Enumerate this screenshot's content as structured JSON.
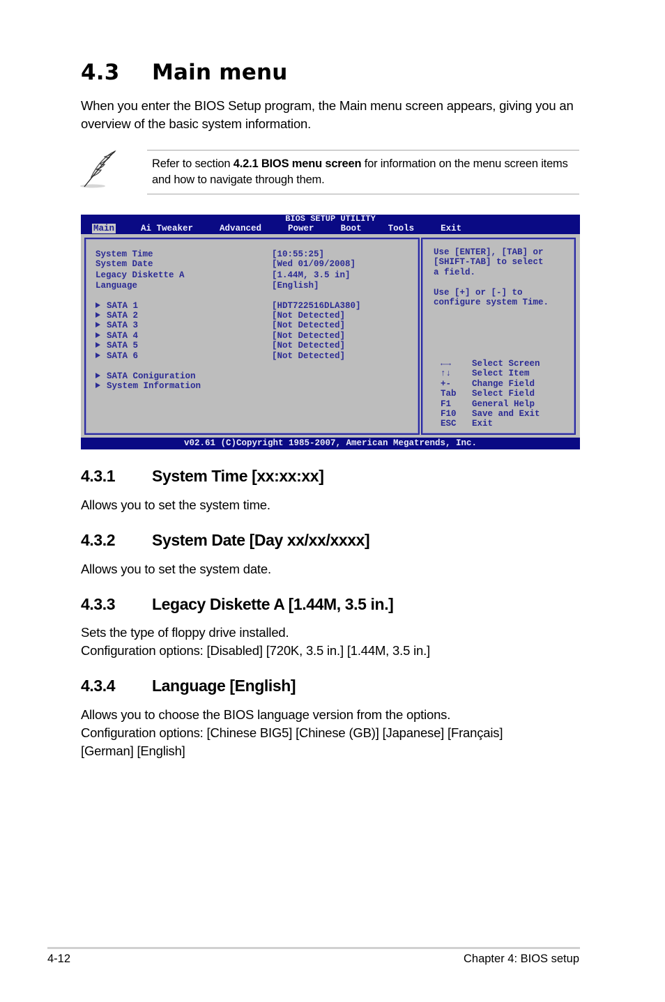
{
  "section": {
    "number": "4.3",
    "title": "Main menu",
    "intro": "When you enter the BIOS Setup program, the Main menu screen appears, giving you an overview of the basic system information."
  },
  "note": {
    "icon": "quill-pen-icon",
    "prefix": "Refer to section ",
    "bold": "4.2.1 BIOS menu screen",
    "suffix": " for information on the menu screen items and how to navigate through them."
  },
  "bios": {
    "title": "BIOS SETUP UTILITY",
    "tabs": [
      {
        "label": "Main",
        "active": true
      },
      {
        "label": "Ai Tweaker",
        "active": false
      },
      {
        "label": "Advanced",
        "active": false
      },
      {
        "label": "Power",
        "active": false
      },
      {
        "label": "Boot",
        "active": false
      },
      {
        "label": "Tools",
        "active": false
      },
      {
        "label": "Exit",
        "active": false
      }
    ],
    "settings": [
      {
        "label": "System Time",
        "value": "[10:55:25]"
      },
      {
        "label": "System Date",
        "value": "[Wed 01/09/2008]"
      },
      {
        "label": "Legacy Diskette A",
        "value": "[1.44M, 3.5 in]"
      },
      {
        "label": "Language",
        "value": "[English]"
      }
    ],
    "sata": [
      {
        "label": "SATA 1",
        "value": "[HDT722516DLA380]"
      },
      {
        "label": "SATA 2",
        "value": "[Not Detected]"
      },
      {
        "label": "SATA 3",
        "value": "[Not Detected]"
      },
      {
        "label": "SATA 4",
        "value": "[Not Detected]"
      },
      {
        "label": "SATA 5",
        "value": "[Not Detected]"
      },
      {
        "label": "SATA 6",
        "value": "[Not Detected]"
      }
    ],
    "submenus": [
      {
        "label": "SATA Coniguration"
      },
      {
        "label": "System Information"
      }
    ],
    "help": {
      "line1": "Use [ENTER], [TAB] or",
      "line2": "[SHIFT-TAB] to select",
      "line3": "a field.",
      "line4": "Use [+] or [-] to",
      "line5": "configure system Time."
    },
    "keys": [
      {
        "key": "←→",
        "action": "Select Screen"
      },
      {
        "key": "↑↓",
        "action": "Select Item"
      },
      {
        "key": "+-",
        "action": "Change Field"
      },
      {
        "key": "Tab",
        "action": "Select Field"
      },
      {
        "key": "F1",
        "action": "General Help"
      },
      {
        "key": "F10",
        "action": "Save and Exit"
      },
      {
        "key": "ESC",
        "action": "Exit"
      }
    ],
    "footer": "v02.61 (C)Copyright 1985-2007, American Megatrends, Inc.",
    "colors": {
      "frame": "#0a0a84",
      "panel": "#bdbdbd",
      "text": "#2b2b94"
    }
  },
  "subsections": [
    {
      "number": "4.3.1",
      "title": "System Time [xx:xx:xx]",
      "lines": [
        "Allows you to set the system time."
      ]
    },
    {
      "number": "4.3.2",
      "title": "System Date [Day xx/xx/xxxx]",
      "lines": [
        "Allows you to set the system date."
      ]
    },
    {
      "number": "4.3.3",
      "title": "Legacy Diskette A [1.44M, 3.5 in.]",
      "lines": [
        "Sets the type of floppy drive installed.",
        "Configuration options: [Disabled] [720K, 3.5 in.] [1.44M, 3.5 in.]"
      ]
    },
    {
      "number": "4.3.4",
      "title": "Language [English]",
      "lines": [
        "Allows you to choose the BIOS language version from the options.",
        "Configuration options: [Chinese BIG5] [Chinese (GB)] [Japanese] [Français]",
        "[German] [English]"
      ]
    }
  ],
  "footer": {
    "page": "4-12",
    "chapter": "Chapter 4: BIOS setup"
  }
}
